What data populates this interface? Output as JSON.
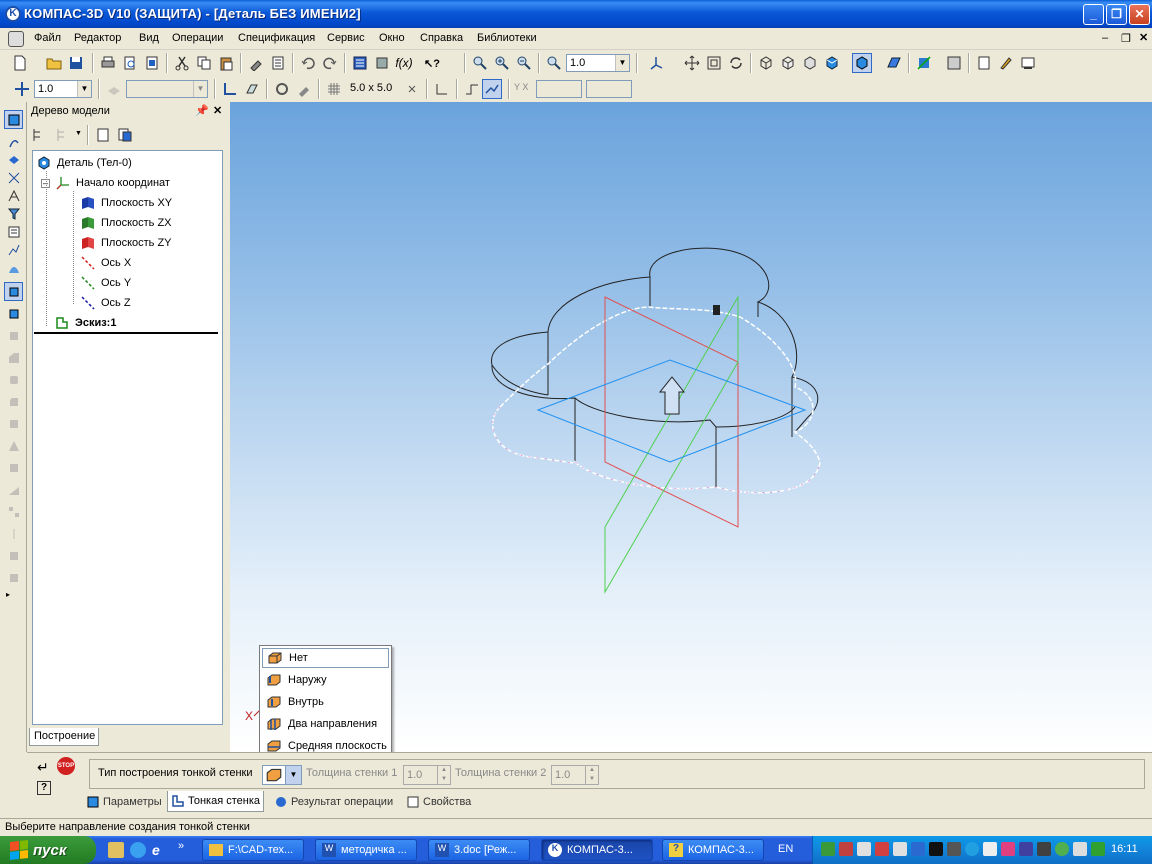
{
  "window": {
    "title": "КОМПАС-3D V10 (ЗАЩИТА) - [Деталь БЕЗ ИМЕНИ2]"
  },
  "menu": [
    "Файл",
    "Редактор",
    "Вид",
    "Операции",
    "Спецификация",
    "Сервис",
    "Окно",
    "Справка",
    "Библиотеки"
  ],
  "toolbar1": {
    "scale_value": "1.0"
  },
  "toolbar2": {
    "step_value": "1.0",
    "grid_value": "5.0 x 5.0"
  },
  "tree": {
    "header": "Дерево модели",
    "root": "Деталь (Тел-0)",
    "origin": "Начало координат",
    "items": [
      "Плоскость XY",
      "Плоскость ZX",
      "Плоскость ZY",
      "Ось X",
      "Ось Y",
      "Ось Z"
    ],
    "sketch": "Эскиз:1",
    "tab": "Построение"
  },
  "colors": {
    "plane_xy": "#1a3aa8",
    "plane_zx": "#2a7a2a",
    "plane_zy": "#cc2222",
    "axis_x": "#d02020",
    "axis_y": "#1a8a1a",
    "axis_z": "#1a1aaa"
  },
  "dropdown": {
    "items": [
      "Нет",
      "Наружу",
      "Внутрь",
      "Два направления",
      "Средняя плоскость"
    ],
    "selected": "Нет"
  },
  "properties": {
    "label": "Тип построения тонкой стенки",
    "thickness1_label": "Толщина стенки 1",
    "thickness1_value": "1.0",
    "thickness2_label": "Толщина стенки 2",
    "thickness2_value": "1.0",
    "tabs": [
      "Параметры",
      "Тонкая стенка",
      "Результат операции",
      "Свойства"
    ],
    "active_tab": "Тонкая стенка"
  },
  "status": "Выберите направление создания тонкой стенки",
  "taskbar": {
    "start": "пуск",
    "tasks": [
      "F:\\CAD-тех...",
      "методичка ...",
      "3.doc [Реж...",
      "КОМПАС-3...",
      "КОМПАС-3..."
    ],
    "lang": "EN",
    "clock": "16:11"
  },
  "viewport": {
    "triad_label": "X"
  }
}
